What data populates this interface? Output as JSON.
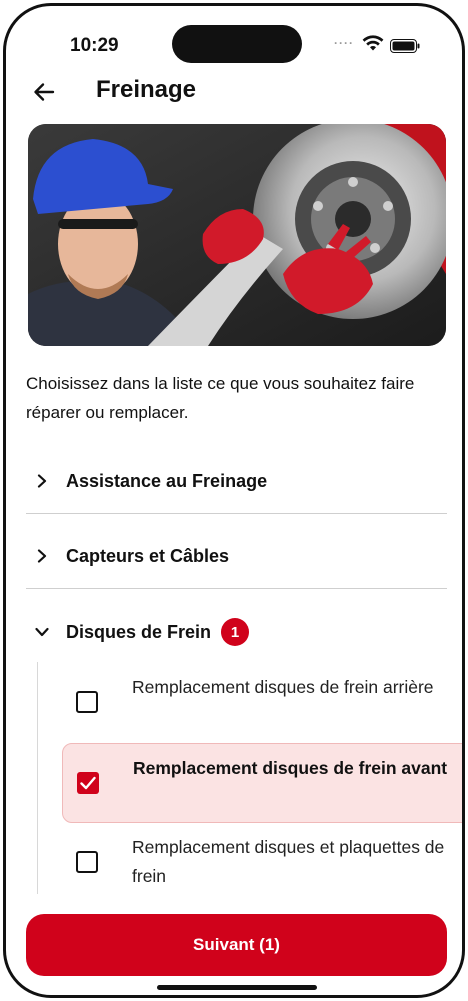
{
  "status_bar": {
    "time": "10:29",
    "signal_dots": "····"
  },
  "header": {
    "title": "Freinage",
    "back_icon": "arrow-left-icon"
  },
  "hero": {
    "image": "mechanic-brake-disc-photo"
  },
  "intro_text": "Choisissez dans la liste ce que vous souhaitez faire réparer ou remplacer.",
  "sections": [
    {
      "label": "Assistance au Freinage",
      "expanded": false,
      "icon": "chevron-right-icon"
    },
    {
      "label": "Capteurs et Câbles",
      "expanded": false,
      "icon": "chevron-right-icon"
    },
    {
      "label": "Disques de Frein",
      "expanded": true,
      "icon": "chevron-down-icon",
      "badge": "1"
    }
  ],
  "options": [
    {
      "label": "Remplacement disques de frein arrière",
      "checked": false
    },
    {
      "label": "Remplacement disques de frein avant",
      "checked": true
    },
    {
      "label": "Remplacement disques et plaquettes de frein",
      "checked": false
    }
  ],
  "footer": {
    "button_label": "Suivant (1)"
  },
  "colors": {
    "accent": "#d0021b",
    "selected_bg": "#fbe3e3"
  }
}
